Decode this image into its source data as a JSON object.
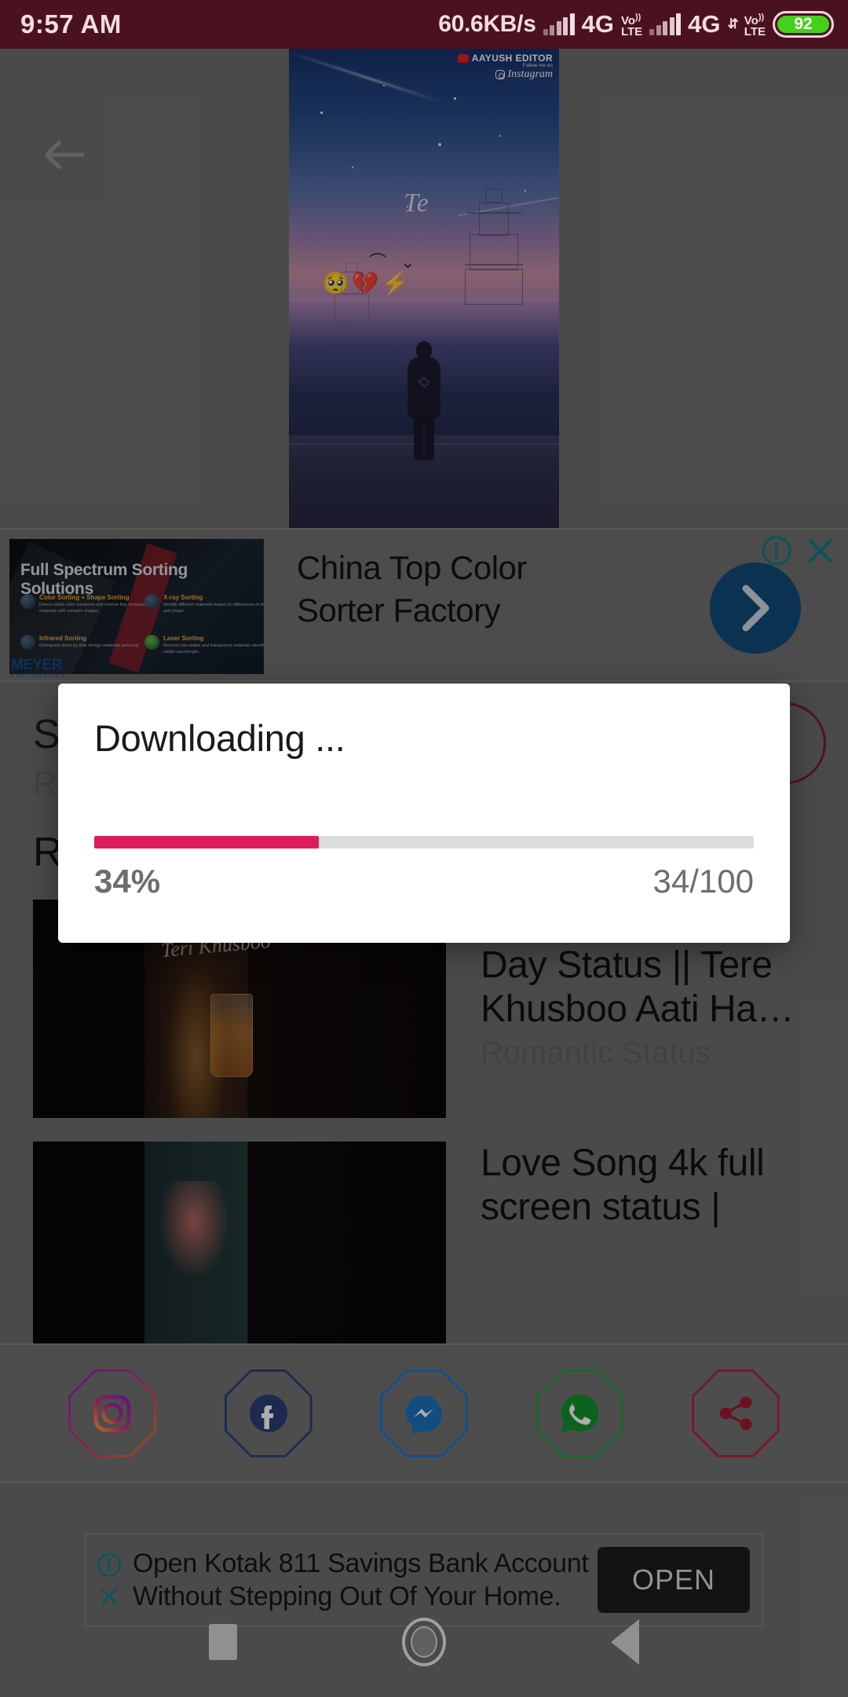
{
  "status_bar": {
    "time": "9:57 AM",
    "network_speed": "60.6KB/s",
    "sim1_network": "4G",
    "sim1_volte": "VoLTE",
    "sim2_network": "4G",
    "sim2_volte": "VoLTE",
    "battery_percent": "92"
  },
  "app": {
    "back_icon": "arrow-left-icon"
  },
  "video": {
    "watermark_name": "AAYUSH EDITOR",
    "watermark_sub": "Follow me on",
    "watermark_platform": "Instagram",
    "overlay_text": "Te",
    "overlay_emoji": "🥺💔⚡"
  },
  "ad_top": {
    "creative_headline": "Full Spectrum Sorting Solutions",
    "features": [
      {
        "title": "Color Sorting + Shape Sorting",
        "body": "Detect subtle color variations and remove tiny, irregularly materials with complex shapes."
      },
      {
        "title": "X-ray Sorting",
        "body": "Identify different materials based on differences of density and shape."
      },
      {
        "title": "Infrared Sorting",
        "body": "Distinguish items by their foreign materials precisely."
      },
      {
        "title": "Laser Sorting",
        "body": "Remove low-visible and transparent materials identified by visible wavelength."
      }
    ],
    "title_line1": "China Top Color",
    "title_line2": "Sorter Factory",
    "brand_name": "MEYER",
    "brand_sub": "CORPORATION",
    "info_icon": "info-icon",
    "close_icon": "close-icon",
    "cta_icon": "chevron-right-icon"
  },
  "main": {
    "video_title": "S…\nS…",
    "video_subtitle": "R…",
    "section_heading": "Related videos :",
    "related": [
      {
        "title": "International Tea Day Status || Tere Khusboo Aati Ha…",
        "subtitle": "Romantic Status",
        "thumb_text": "Teri Khusboo"
      },
      {
        "title": "Love Song 4k full screen status |",
        "subtitle": "",
        "thumb_text": ""
      }
    ]
  },
  "share_bar": {
    "buttons": [
      {
        "name": "instagram",
        "label": "Instagram",
        "color": "#8a3ab9"
      },
      {
        "name": "facebook",
        "label": "Facebook",
        "color": "#2f4178"
      },
      {
        "name": "messenger",
        "label": "Messenger",
        "color": "#1877d2"
      },
      {
        "name": "whatsapp",
        "label": "WhatsApp",
        "color": "#1f9a43"
      },
      {
        "name": "share",
        "label": "Share",
        "color": "#b5223c"
      }
    ]
  },
  "ad_bottom": {
    "text_line1": "Open Kotak 811 Savings Bank Account",
    "text_line2": "Without Stepping Out Of Your Home.",
    "button_label": "OPEN",
    "info_icon": "info-icon",
    "close_icon": "close-icon"
  },
  "dialog": {
    "title": "Downloading ...",
    "percent_label": "34%",
    "count_label": "34/100",
    "progress_value": 34,
    "progress_max": 100,
    "accent_color": "#dd1c5d",
    "track_color": "#dcdcdc"
  },
  "navigation_bar": {
    "recents_icon": "square-icon",
    "home_icon": "circle-icon",
    "back_icon": "triangle-back-icon"
  }
}
